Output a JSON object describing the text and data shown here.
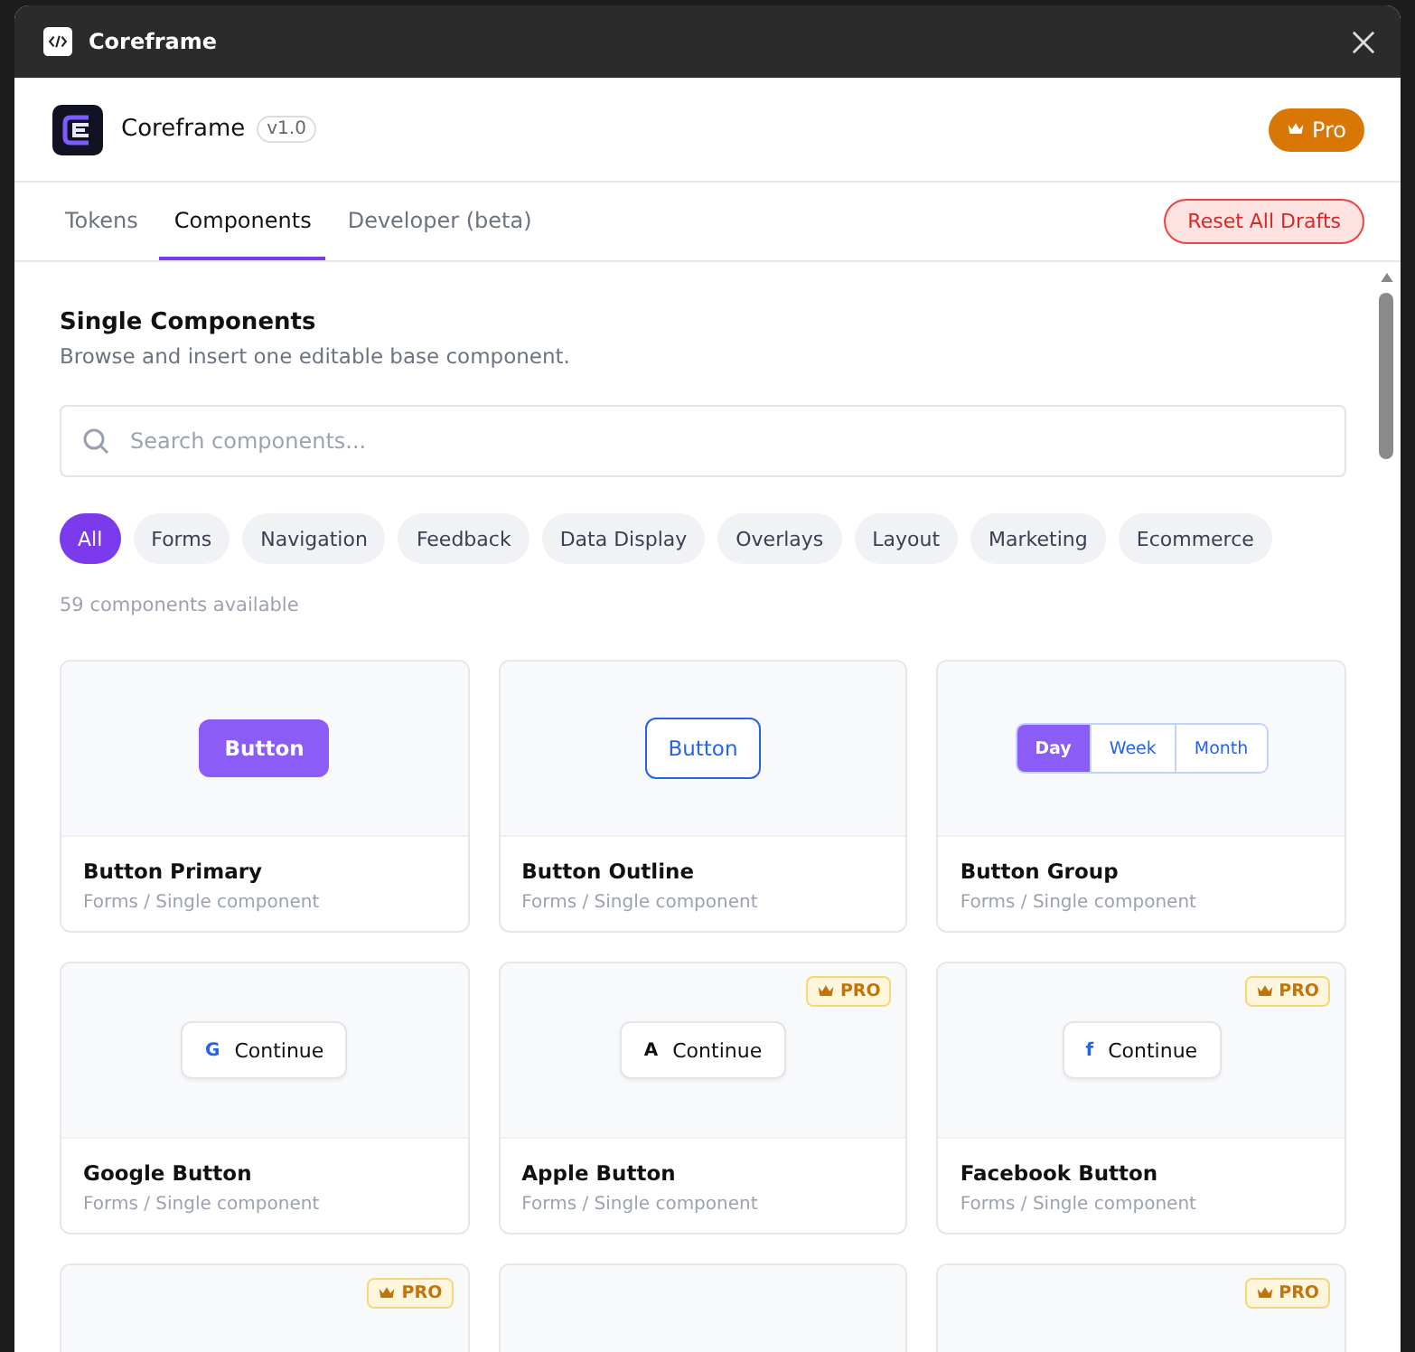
{
  "window": {
    "title": "Coreframe"
  },
  "header": {
    "app_name": "Coreframe",
    "version": "v1.0",
    "plan_badge": "Pro"
  },
  "tabs": [
    {
      "label": "Tokens",
      "selected": false
    },
    {
      "label": "Components",
      "selected": true
    },
    {
      "label": "Developer (beta)",
      "selected": false
    }
  ],
  "reset_button": "Reset All Drafts",
  "section": {
    "title": "Single Components",
    "subtitle": "Browse and insert one editable base component."
  },
  "search": {
    "placeholder": "Search components..."
  },
  "filters": [
    {
      "label": "All",
      "selected": true
    },
    {
      "label": "Forms",
      "selected": false
    },
    {
      "label": "Navigation",
      "selected": false
    },
    {
      "label": "Feedback",
      "selected": false
    },
    {
      "label": "Data Display",
      "selected": false
    },
    {
      "label": "Overlays",
      "selected": false
    },
    {
      "label": "Layout",
      "selected": false
    },
    {
      "label": "Marketing",
      "selected": false
    },
    {
      "label": "Ecommerce",
      "selected": false
    }
  ],
  "count": "59 components available",
  "cards": [
    {
      "name": "Button Primary",
      "category": "Forms / Single component",
      "preview": {
        "kind": "primary",
        "label": "Button"
      }
    },
    {
      "name": "Button Outline",
      "category": "Forms / Single component",
      "preview": {
        "kind": "outline",
        "label": "Button"
      }
    },
    {
      "name": "Button Group",
      "category": "Forms / Single component",
      "preview": {
        "kind": "group",
        "segments": [
          {
            "label": "Day",
            "selected": true
          },
          {
            "label": "Week",
            "selected": false
          },
          {
            "label": "Month",
            "selected": false
          }
        ]
      }
    },
    {
      "name": "Google Button",
      "category": "Forms / Single component",
      "preview": {
        "kind": "social",
        "glyph": "G",
        "label": "Continue"
      }
    },
    {
      "name": "Apple Button",
      "category": "Forms / Single component",
      "badge": "PRO",
      "preview": {
        "kind": "social",
        "glyph": "A",
        "label": "Continue"
      }
    },
    {
      "name": "Facebook Button",
      "category": "Forms / Single component",
      "badge": "PRO",
      "preview": {
        "kind": "social",
        "glyph": "f",
        "label": "Continue"
      }
    },
    {
      "badge": "PRO",
      "preview": {
        "kind": "hidden"
      }
    },
    {
      "preview": {
        "kind": "hidden"
      }
    },
    {
      "badge": "PRO",
      "preview": {
        "kind": "hidden"
      }
    }
  ]
}
